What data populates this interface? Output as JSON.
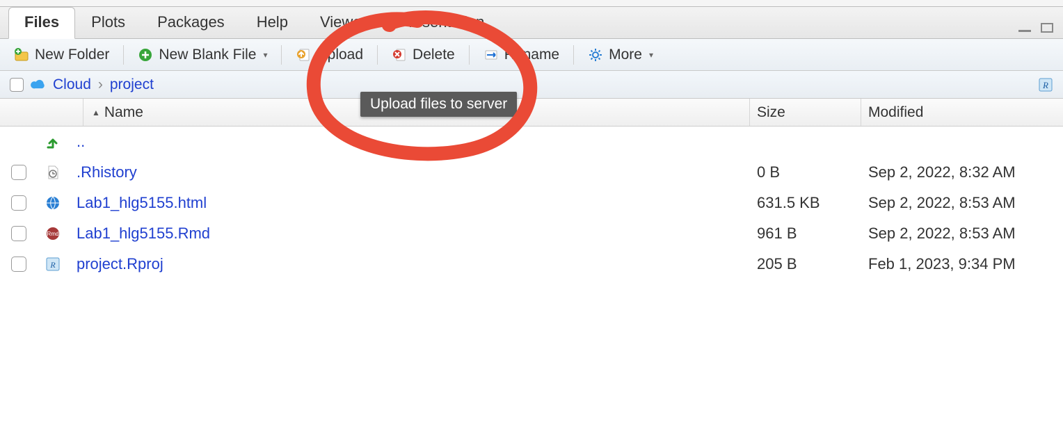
{
  "tabs": {
    "items": [
      {
        "label": "Files",
        "active": true
      },
      {
        "label": "Plots",
        "active": false
      },
      {
        "label": "Packages",
        "active": false
      },
      {
        "label": "Help",
        "active": false
      },
      {
        "label": "Viewer",
        "active": false
      },
      {
        "label": "Presentation",
        "active": false
      }
    ]
  },
  "toolbar": {
    "new_folder": "New Folder",
    "new_blank": "New Blank File",
    "upload": "Upload",
    "delete": "Delete",
    "rename": "Rename",
    "more": "More"
  },
  "breadcrumb": {
    "root": "Cloud",
    "path": "project"
  },
  "columns": {
    "name": "Name",
    "size": "Size",
    "modified": "Modified"
  },
  "parent_dir_label": "..",
  "files": [
    {
      "name": ".Rhistory",
      "size": "0 B",
      "modified": "Sep 2, 2022, 8:32 AM",
      "kind": "history"
    },
    {
      "name": "Lab1_hlg5155.html",
      "size": "631.5 KB",
      "modified": "Sep 2, 2022, 8:53 AM",
      "kind": "html"
    },
    {
      "name": "Lab1_hlg5155.Rmd",
      "size": "961 B",
      "modified": "Sep 2, 2022, 8:53 AM",
      "kind": "rmd"
    },
    {
      "name": "project.Rproj",
      "size": "205 B",
      "modified": "Feb 1, 2023, 9:34 PM",
      "kind": "rproj"
    }
  ],
  "tooltip": "Upload files to server"
}
